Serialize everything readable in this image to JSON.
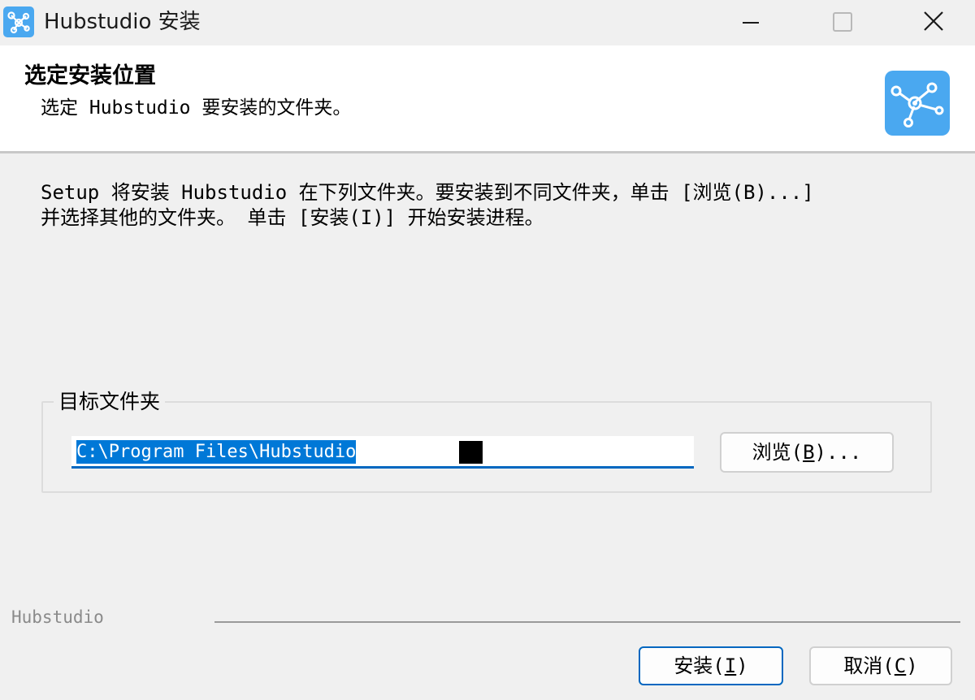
{
  "window": {
    "title": "Hubstudio 安装",
    "controls": {
      "minimize": "minimize",
      "maximize": "maximize",
      "close": "close"
    }
  },
  "header": {
    "heading": "选定安装位置",
    "subheading": "选定 Hubstudio 要安装的文件夹。",
    "logo_icon": "hubstudio-network-logo"
  },
  "body": {
    "description_lines": [
      "Setup 将安装 Hubstudio 在下列文件夹。要安装到不同文件夹，单击 [浏览(B)...]",
      "并选择其他的文件夹。 单击 [安装(I)] 开始安装进程。"
    ]
  },
  "destination": {
    "group_label": "目标文件夹",
    "path_value": "C:\\Program Files\\Hubstudio",
    "browse": {
      "prefix": "浏览(",
      "mnemonic": "B",
      "suffix": ")..."
    }
  },
  "footer": {
    "brand": "Hubstudio",
    "install": {
      "prefix": "安装(",
      "mnemonic": "I",
      "suffix": ")"
    },
    "cancel": {
      "prefix": "取消(",
      "mnemonic": "C",
      "suffix": ")"
    }
  },
  "colors": {
    "accent": "#0067c0",
    "selection": "#0078d7",
    "logo": "#4aa8f0"
  }
}
